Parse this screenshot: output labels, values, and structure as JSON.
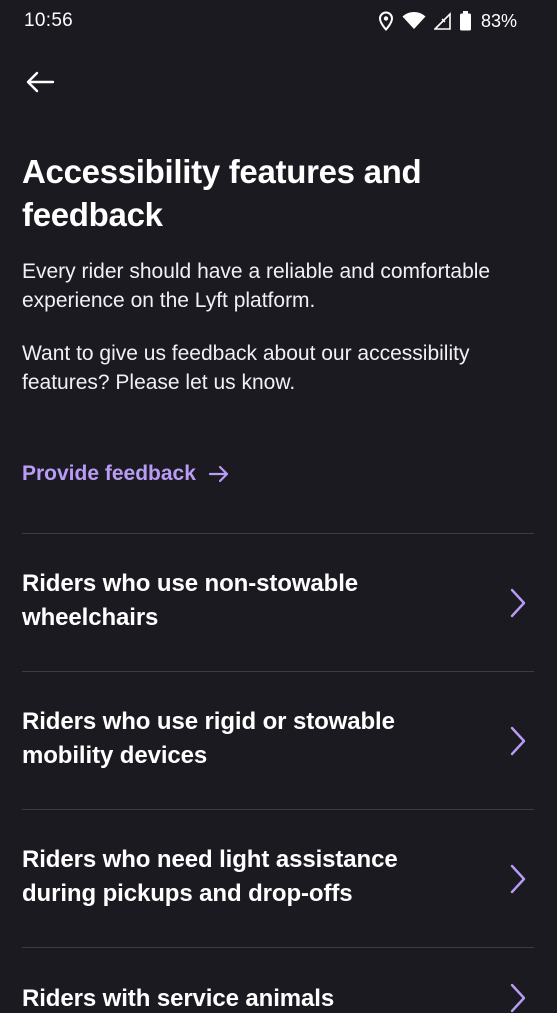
{
  "status_bar": {
    "time": "10:56",
    "battery": "83%",
    "icons": [
      "location-icon",
      "wifi-icon",
      "cell-signal-icon",
      "battery-icon"
    ]
  },
  "header": {
    "back_icon": "arrow-left-icon"
  },
  "title": "Accessibility features and feedback",
  "paragraphs": [
    "Every rider should have a reliable and comfortable experience on the Lyft platform.",
    "Want to give us feedback about our accessibility features? Please let us know."
  ],
  "feedback_link": {
    "label": "Provide feedback",
    "icon": "arrow-right-icon"
  },
  "rows": [
    {
      "label": "Riders who use non-stowable wheelchairs",
      "icon": "chevron-right-icon"
    },
    {
      "label": "Riders who use rigid or stowable mobility devices",
      "icon": "chevron-right-icon"
    },
    {
      "label": "Riders who need light assistance during pickups and drop-offs",
      "icon": "chevron-right-icon"
    },
    {
      "label": "Riders with service animals",
      "icon": "chevron-right-icon"
    }
  ],
  "colors": {
    "background": "#1b1a21",
    "accent": "#b89cf5",
    "divider": "#3c3b44",
    "text": "#ffffff"
  }
}
